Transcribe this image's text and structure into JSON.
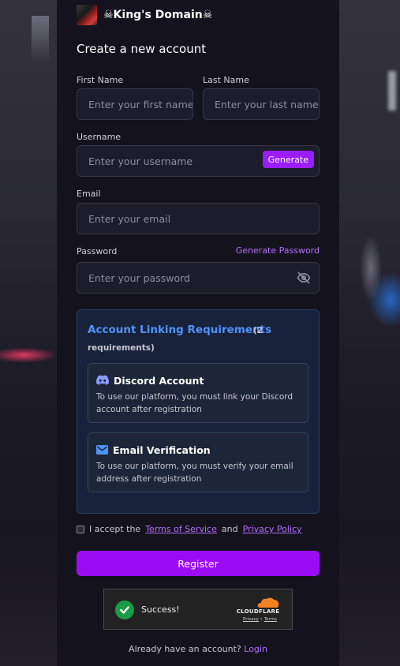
{
  "brand": {
    "title": "☠King's Domain☠"
  },
  "page": {
    "title": "Create a new account"
  },
  "form": {
    "first_name": {
      "label": "First Name",
      "placeholder": "Enter your first name"
    },
    "last_name": {
      "label": "Last Name",
      "placeholder": "Enter your last name"
    },
    "username": {
      "label": "Username",
      "placeholder": "Enter your username",
      "generate_label": "Generate"
    },
    "email": {
      "label": "Email",
      "placeholder": "Enter your email"
    },
    "password": {
      "label": "Password",
      "placeholder": "Enter your password",
      "generate_link": "Generate Password",
      "toggle_icon": "eye-off-icon"
    }
  },
  "requirements": {
    "title": "Account Linking Requirements",
    "count_prefix": "(2",
    "count_suffix": "requirements)",
    "items": [
      {
        "icon": "discord-icon",
        "title": "Discord Account",
        "description": "To use our platform, you must link your Discord account after registration"
      },
      {
        "icon": "mail-icon",
        "title": "Email Verification",
        "description": "To use our platform, you must verify your email address after registration"
      }
    ]
  },
  "terms": {
    "prefix": "I accept the",
    "tos": "Terms of Service",
    "and": "and",
    "privacy": "Privacy Policy",
    "checked": false
  },
  "register_label": "Register",
  "captcha": {
    "status": "Success!",
    "provider": "CLOUDFLARE",
    "privacy": "Privacy",
    "separator": "•",
    "terms": "Terms"
  },
  "footer": {
    "prompt": "Already have an account?",
    "login": "Login"
  },
  "colors": {
    "accent": "#9b0cf5",
    "link": "#b66cff",
    "req_title": "#4f93ff",
    "success": "#1a9b46",
    "cloudflare": "#f48120"
  }
}
